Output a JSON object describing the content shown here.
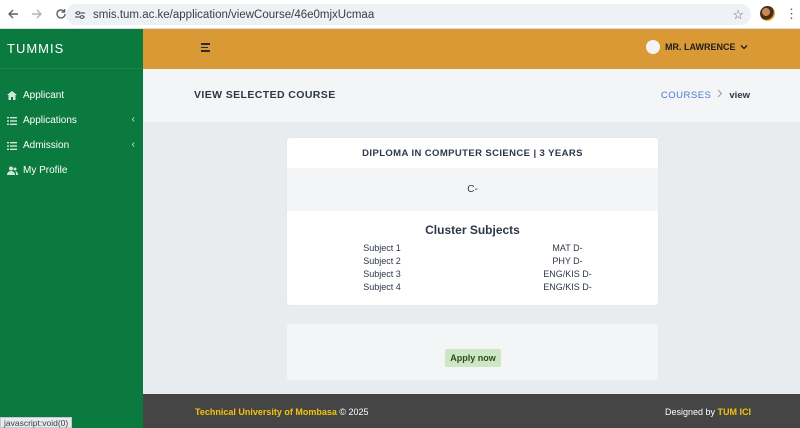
{
  "browser": {
    "url": "smis.tum.ac.ke/application/viewCourse/46e0mjxUcmaa",
    "back_icon": "arrow-left-icon",
    "forward_icon": "arrow-right-icon",
    "reload_icon": "reload-icon",
    "bookmark_icon": "star-icon",
    "menu_icon": "kebab-icon"
  },
  "sidebar": {
    "brand": "TUMMIS",
    "items": [
      {
        "label": "Applicant",
        "icon": "home-icon",
        "has_submenu": false
      },
      {
        "label": "Applications",
        "icon": "list-icon",
        "has_submenu": true
      },
      {
        "label": "Admission",
        "icon": "list-icon",
        "has_submenu": true
      },
      {
        "label": "My Profile",
        "icon": "users-icon",
        "has_submenu": false
      }
    ],
    "color": "#0b7a3e"
  },
  "topbar": {
    "user_name": "MR. LAWRENCE",
    "color": "#d99a35"
  },
  "page_header": {
    "title": "VIEW SELECTED COURSE",
    "breadcrumb": {
      "link": "COURSES",
      "current": "view"
    }
  },
  "course": {
    "title": "DIPLOMA IN COMPUTER SCIENCE | 3 YEARS",
    "min_grade": "C-",
    "cluster_title": "Cluster Subjects",
    "subjects": [
      {
        "name": "Subject 1",
        "grade": "MAT D-"
      },
      {
        "name": "Subject 2",
        "grade": "PHY D-"
      },
      {
        "name": "Subject 3",
        "grade": "ENG/KIS D-"
      },
      {
        "name": "Subject 4",
        "grade": "ENG/KIS D-"
      }
    ]
  },
  "actions": {
    "apply_label": "Apply now"
  },
  "footer": {
    "university": "Technical University of Mombasa",
    "copyright": " © 2025",
    "designed_by": "Designed by ",
    "designer": "TUM ICI"
  },
  "status_bar": {
    "text": "javascript:void(0)"
  }
}
